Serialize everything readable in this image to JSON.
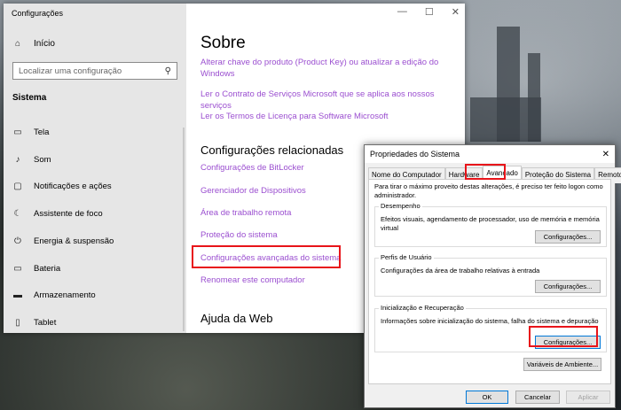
{
  "settings": {
    "title": "Configurações",
    "controls": {
      "minimize": "—",
      "maximize": "☐",
      "close": "✕"
    },
    "home_label": "Início",
    "search_placeholder": "Localizar uma configuração",
    "section": "Sistema",
    "nav": [
      {
        "label": "Tela",
        "icon": "monitor-icon",
        "glyph": "▭"
      },
      {
        "label": "Som",
        "icon": "speaker-icon",
        "glyph": "♪"
      },
      {
        "label": "Notificações e ações",
        "icon": "notification-icon",
        "glyph": "▢"
      },
      {
        "label": "Assistente de foco",
        "icon": "moon-icon",
        "glyph": "☾"
      },
      {
        "label": "Energia & suspensão",
        "icon": "power-icon",
        "glyph": "⏻"
      },
      {
        "label": "Bateria",
        "icon": "battery-icon",
        "glyph": "▭"
      },
      {
        "label": "Armazenamento",
        "icon": "storage-icon",
        "glyph": "▬"
      },
      {
        "label": "Tablet",
        "icon": "tablet-icon",
        "glyph": "▯"
      }
    ],
    "page_title": "Sobre",
    "links_top": [
      "Alterar chave do produto (Product Key) ou atualizar a edição do Windows",
      "Ler o Contrato de Serviços Microsoft que se aplica aos nossos serviços",
      "Ler os Termos de Licença para Software Microsoft"
    ],
    "related_heading": "Configurações relacionadas",
    "related_links": [
      "Configurações de BitLocker",
      "Gerenciador de Dispositivos",
      "Área de trabalho remota",
      "Proteção do sistema",
      "Configurações avançadas do sistema",
      "Renomear este computador"
    ],
    "help_heading": "Ajuda da Web"
  },
  "dialog": {
    "title": "Propriedades do Sistema",
    "close": "✕",
    "tabs": [
      "Nome do Computador",
      "Hardware",
      "Avançado",
      "Proteção do Sistema",
      "Remoto"
    ],
    "intro": "Para tirar o máximo proveito destas alterações, é preciso ter feito logon como administrador.",
    "groups": [
      {
        "title": "Desempenho",
        "desc": "Efeitos visuais, agendamento de processador, uso de memória e memória virtual",
        "button": "Configurações..."
      },
      {
        "title": "Perfis de Usuário",
        "desc": "Configurações da área de trabalho relativas à entrada",
        "button": "Configurações..."
      },
      {
        "title": "Inicialização e Recuperação",
        "desc": "Informações sobre inicialização do sistema, falha do sistema e depuração",
        "button": "Configurações..."
      }
    ],
    "env_button": "Variáveis de Ambiente...",
    "ok": "OK",
    "cancel": "Cancelar",
    "apply": "Aplicar"
  },
  "colors": {
    "link": "#9b4fd0",
    "highlight": "#e8141a",
    "accent": "#0078d7"
  }
}
